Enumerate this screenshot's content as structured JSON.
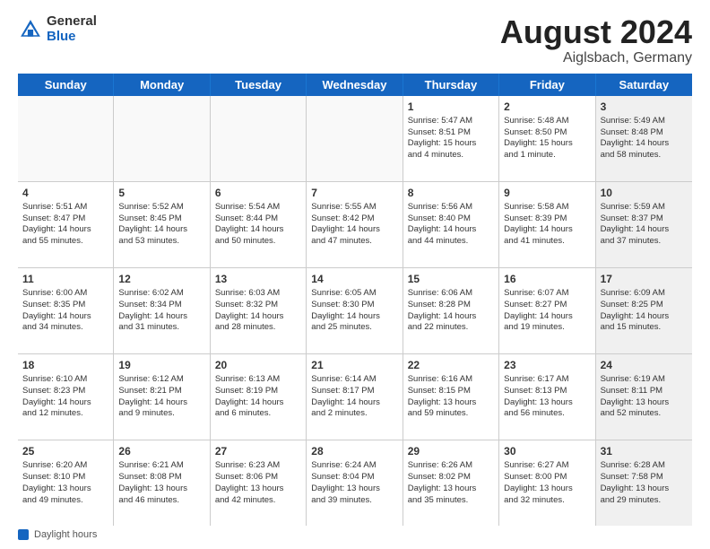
{
  "header": {
    "logo": {
      "general": "General",
      "blue": "Blue"
    },
    "month_year": "August 2024",
    "location": "Aiglsbach, Germany"
  },
  "footer": {
    "label": "Daylight hours"
  },
  "weekdays": [
    "Sunday",
    "Monday",
    "Tuesday",
    "Wednesday",
    "Thursday",
    "Friday",
    "Saturday"
  ],
  "rows": [
    [
      {
        "day": "",
        "info": "",
        "empty": true
      },
      {
        "day": "",
        "info": "",
        "empty": true
      },
      {
        "day": "",
        "info": "",
        "empty": true
      },
      {
        "day": "",
        "info": "",
        "empty": true
      },
      {
        "day": "1",
        "info": "Sunrise: 5:47 AM\nSunset: 8:51 PM\nDaylight: 15 hours\nand 4 minutes."
      },
      {
        "day": "2",
        "info": "Sunrise: 5:48 AM\nSunset: 8:50 PM\nDaylight: 15 hours\nand 1 minute."
      },
      {
        "day": "3",
        "info": "Sunrise: 5:49 AM\nSunset: 8:48 PM\nDaylight: 14 hours\nand 58 minutes.",
        "shaded": true
      }
    ],
    [
      {
        "day": "4",
        "info": "Sunrise: 5:51 AM\nSunset: 8:47 PM\nDaylight: 14 hours\nand 55 minutes."
      },
      {
        "day": "5",
        "info": "Sunrise: 5:52 AM\nSunset: 8:45 PM\nDaylight: 14 hours\nand 53 minutes."
      },
      {
        "day": "6",
        "info": "Sunrise: 5:54 AM\nSunset: 8:44 PM\nDaylight: 14 hours\nand 50 minutes."
      },
      {
        "day": "7",
        "info": "Sunrise: 5:55 AM\nSunset: 8:42 PM\nDaylight: 14 hours\nand 47 minutes."
      },
      {
        "day": "8",
        "info": "Sunrise: 5:56 AM\nSunset: 8:40 PM\nDaylight: 14 hours\nand 44 minutes."
      },
      {
        "day": "9",
        "info": "Sunrise: 5:58 AM\nSunset: 8:39 PM\nDaylight: 14 hours\nand 41 minutes."
      },
      {
        "day": "10",
        "info": "Sunrise: 5:59 AM\nSunset: 8:37 PM\nDaylight: 14 hours\nand 37 minutes.",
        "shaded": true
      }
    ],
    [
      {
        "day": "11",
        "info": "Sunrise: 6:00 AM\nSunset: 8:35 PM\nDaylight: 14 hours\nand 34 minutes."
      },
      {
        "day": "12",
        "info": "Sunrise: 6:02 AM\nSunset: 8:34 PM\nDaylight: 14 hours\nand 31 minutes."
      },
      {
        "day": "13",
        "info": "Sunrise: 6:03 AM\nSunset: 8:32 PM\nDaylight: 14 hours\nand 28 minutes."
      },
      {
        "day": "14",
        "info": "Sunrise: 6:05 AM\nSunset: 8:30 PM\nDaylight: 14 hours\nand 25 minutes."
      },
      {
        "day": "15",
        "info": "Sunrise: 6:06 AM\nSunset: 8:28 PM\nDaylight: 14 hours\nand 22 minutes."
      },
      {
        "day": "16",
        "info": "Sunrise: 6:07 AM\nSunset: 8:27 PM\nDaylight: 14 hours\nand 19 minutes."
      },
      {
        "day": "17",
        "info": "Sunrise: 6:09 AM\nSunset: 8:25 PM\nDaylight: 14 hours\nand 15 minutes.",
        "shaded": true
      }
    ],
    [
      {
        "day": "18",
        "info": "Sunrise: 6:10 AM\nSunset: 8:23 PM\nDaylight: 14 hours\nand 12 minutes."
      },
      {
        "day": "19",
        "info": "Sunrise: 6:12 AM\nSunset: 8:21 PM\nDaylight: 14 hours\nand 9 minutes."
      },
      {
        "day": "20",
        "info": "Sunrise: 6:13 AM\nSunset: 8:19 PM\nDaylight: 14 hours\nand 6 minutes."
      },
      {
        "day": "21",
        "info": "Sunrise: 6:14 AM\nSunset: 8:17 PM\nDaylight: 14 hours\nand 2 minutes."
      },
      {
        "day": "22",
        "info": "Sunrise: 6:16 AM\nSunset: 8:15 PM\nDaylight: 13 hours\nand 59 minutes."
      },
      {
        "day": "23",
        "info": "Sunrise: 6:17 AM\nSunset: 8:13 PM\nDaylight: 13 hours\nand 56 minutes."
      },
      {
        "day": "24",
        "info": "Sunrise: 6:19 AM\nSunset: 8:11 PM\nDaylight: 13 hours\nand 52 minutes.",
        "shaded": true
      }
    ],
    [
      {
        "day": "25",
        "info": "Sunrise: 6:20 AM\nSunset: 8:10 PM\nDaylight: 13 hours\nand 49 minutes."
      },
      {
        "day": "26",
        "info": "Sunrise: 6:21 AM\nSunset: 8:08 PM\nDaylight: 13 hours\nand 46 minutes."
      },
      {
        "day": "27",
        "info": "Sunrise: 6:23 AM\nSunset: 8:06 PM\nDaylight: 13 hours\nand 42 minutes."
      },
      {
        "day": "28",
        "info": "Sunrise: 6:24 AM\nSunset: 8:04 PM\nDaylight: 13 hours\nand 39 minutes."
      },
      {
        "day": "29",
        "info": "Sunrise: 6:26 AM\nSunset: 8:02 PM\nDaylight: 13 hours\nand 35 minutes."
      },
      {
        "day": "30",
        "info": "Sunrise: 6:27 AM\nSunset: 8:00 PM\nDaylight: 13 hours\nand 32 minutes."
      },
      {
        "day": "31",
        "info": "Sunrise: 6:28 AM\nSunset: 7:58 PM\nDaylight: 13 hours\nand 29 minutes.",
        "shaded": true
      }
    ]
  ]
}
